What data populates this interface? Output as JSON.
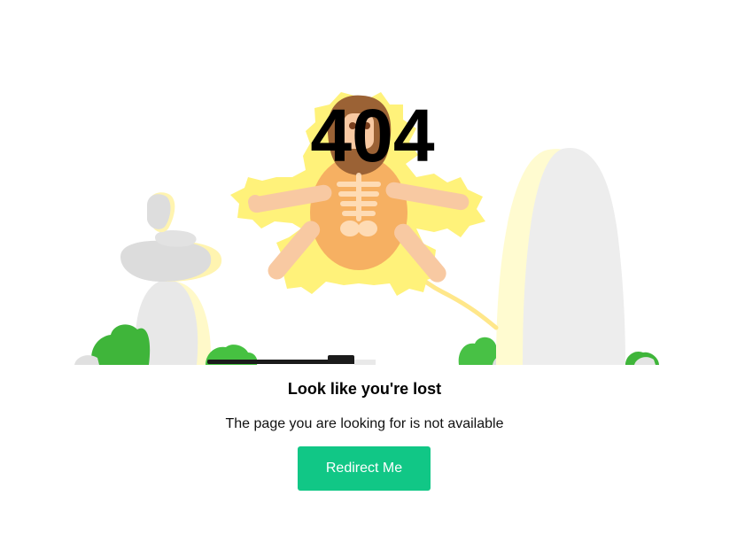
{
  "error": {
    "code": "404"
  },
  "message": {
    "headline": "Look like you're lost",
    "subtext": "The page you are looking for is not available"
  },
  "actions": {
    "redirect_label": "Redirect Me"
  },
  "illustration": {
    "subject": "electrocuted-caveman-skeleton",
    "icons": [
      "stacked-rocks-icon",
      "tombstone-rock-icon",
      "green-bush-icon",
      "fallen-stick-icon",
      "electric-cord-icon"
    ]
  },
  "colors": {
    "button_bg": "#11c786",
    "button_text": "#ffffff",
    "text": "#000000",
    "background": "#ffffff",
    "glow": "#fff27a",
    "rock": "#e8e8e8",
    "bush": "#3fb53a"
  }
}
